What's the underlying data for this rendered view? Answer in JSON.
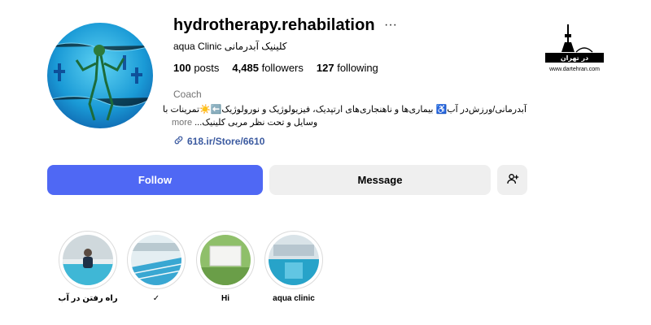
{
  "profile": {
    "username": "hydrotherapy.rehabilation",
    "more_icon": "···",
    "full_name": "aqua Clinic کلینیک آبدرمانی",
    "stats": {
      "posts_count": "100",
      "posts_label": "posts",
      "followers_count": "4,485",
      "followers_label": "followers",
      "following_count": "127",
      "following_label": "following"
    },
    "category": "Coach",
    "bio_line1": "آبدرمانی/ورزش‌در آب♿️ بیماری‌ها و ناهنجاری‌های ارتپدیک، فیزیولوژیک و نورولوژیک⬅️☀️تمرینات با",
    "bio_line2": "وسایل و تحت نظر مربی کلینیک...",
    "bio_more": "more",
    "link_text": "618.ir/Store/6610"
  },
  "actions": {
    "follow_label": "Follow",
    "message_label": "Message",
    "add_user_icon": "person-add-icon"
  },
  "highlights": [
    {
      "label": "راه رفتن در آب"
    },
    {
      "label": "✓"
    },
    {
      "label": "Hi"
    },
    {
      "label": "aqua clinic"
    }
  ],
  "watermark": {
    "logo_text": "در تهران",
    "url": "www.dartehran.com"
  },
  "colors": {
    "follow_button": "#4f68f4",
    "secondary_button": "#efefef",
    "link": "#3b5aa0"
  }
}
